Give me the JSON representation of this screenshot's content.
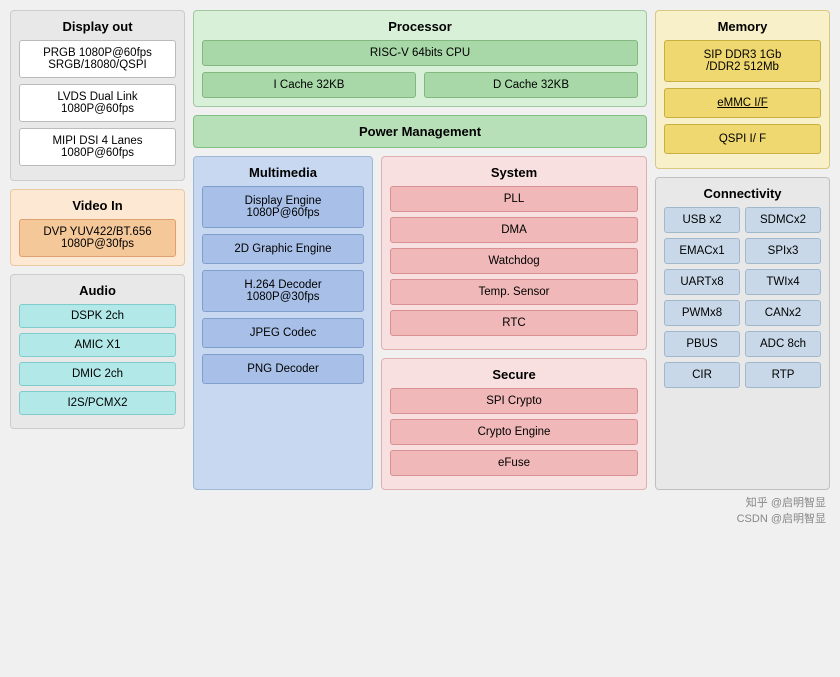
{
  "display_out": {
    "title": "Display out",
    "items": [
      "PRGB 1080P@60fps\nSRGB/18080/QSPI",
      "LVDS Dual Link\n1080P@60fps",
      "MIPI DSI 4 Lanes\n1080P@60fps"
    ]
  },
  "video_in": {
    "title": "Video In",
    "items": [
      "DVP YUV422/BT.656\n1080P@30fps"
    ]
  },
  "audio": {
    "title": "Audio",
    "items": [
      "DSPK 2ch",
      "AMIC X1",
      "DMIC 2ch",
      "I2S/PCMX2"
    ]
  },
  "processor": {
    "title": "Processor",
    "cpu": "RISC-V 64bits CPU",
    "icache": "I  Cache 32KB",
    "dcache": "D Cache 32KB"
  },
  "power_mgmt": {
    "title": "Power Management"
  },
  "multimedia": {
    "title": "Multimedia",
    "items": [
      "Display Engine\n1080P@60fps",
      "2D Graphic Engine",
      "H.264 Decoder\n1080P@30fps",
      "JPEG Codec",
      "PNG Decoder"
    ]
  },
  "system": {
    "title": "System",
    "items": [
      "PLL",
      "DMA",
      "Watchdog",
      "Temp. Sensor",
      "RTC"
    ]
  },
  "secure": {
    "title": "Secure",
    "items": [
      "SPI Crypto",
      "Crypto Engine",
      "eFuse"
    ]
  },
  "memory": {
    "title": "Memory",
    "items": [
      "SIP DDR3 1Gb\n/DDR2 512Mb",
      "eMMC I/F",
      "QSPI I/ F"
    ]
  },
  "connectivity": {
    "title": "Connectivity",
    "items": [
      "USB x2",
      "SDMCx2",
      "EMACx1",
      "SPIx3",
      "UARTx8",
      "TWIx4",
      "PWMx8",
      "CANx2",
      "PBUS",
      "ADC 8ch",
      "CIR",
      "RTP"
    ]
  },
  "watermark": "知乎 @启明智显\nCSDN @启明智显"
}
